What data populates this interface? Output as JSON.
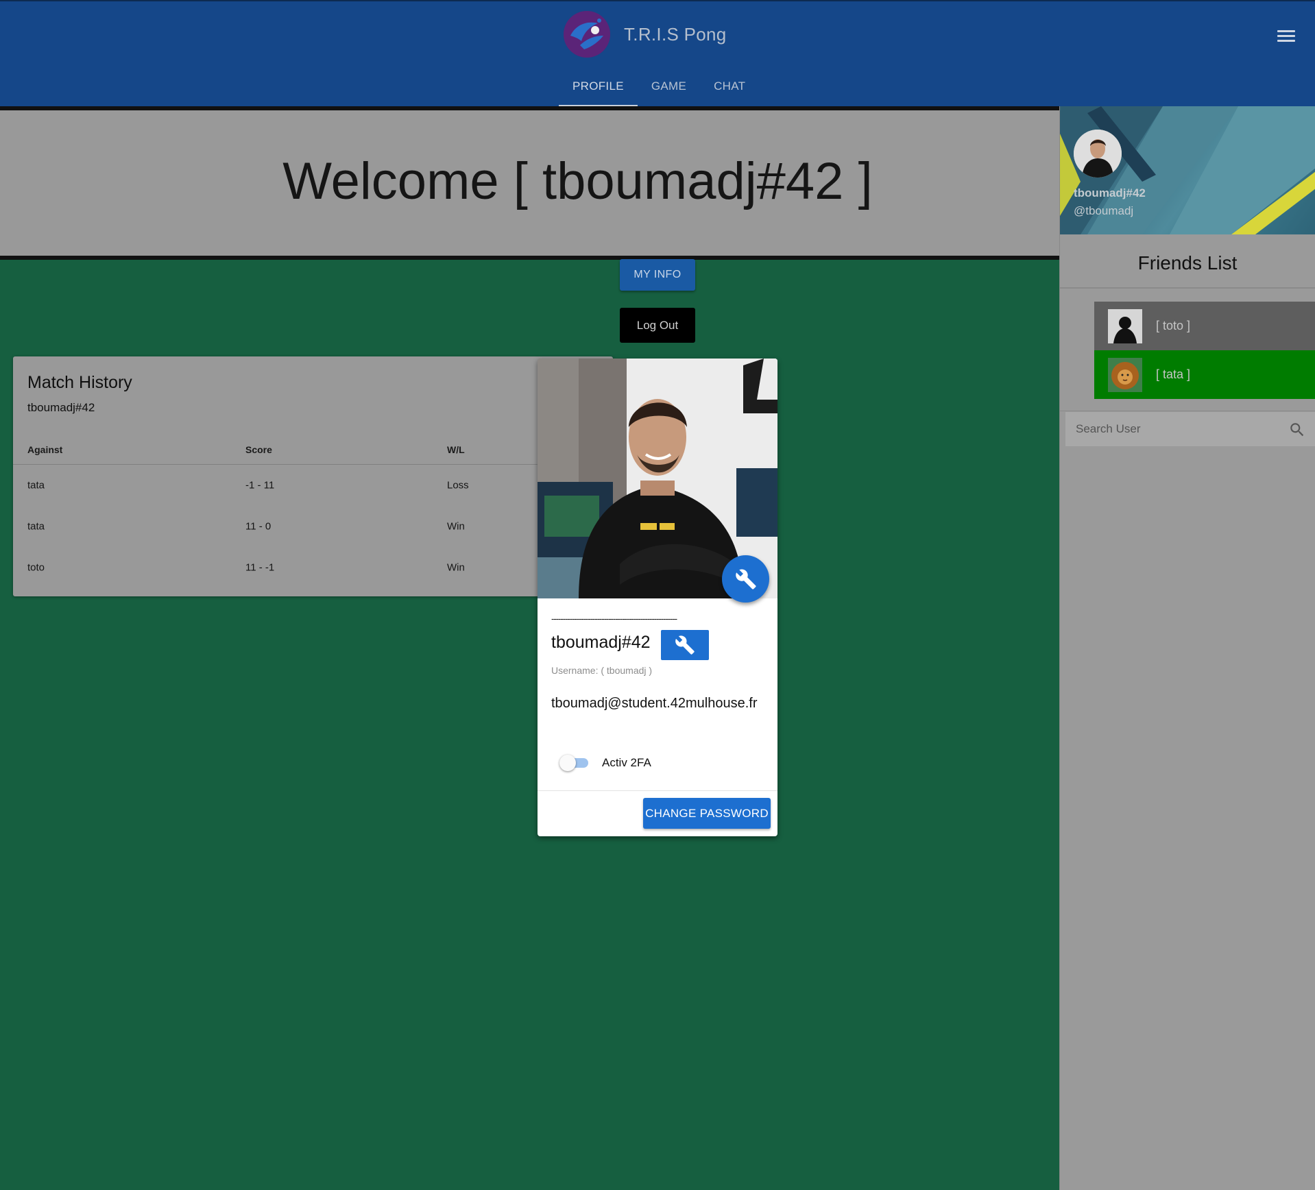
{
  "header": {
    "title": "T.R.I.S Pong",
    "tabs": [
      {
        "label": "PROFILE",
        "active": true
      },
      {
        "label": "GAME",
        "active": false
      },
      {
        "label": "CHAT",
        "active": false
      }
    ],
    "menu_icon": "hamburger-menu-icon",
    "logo_icon": "pong-logo-icon"
  },
  "welcome": {
    "text": "Welcome [ tboumadj#42 ]"
  },
  "buttons": {
    "my_info": "MY INFO",
    "log_out": "Log Out"
  },
  "match_history": {
    "title": "Match History",
    "subtitle": "tboumadj#42",
    "columns": [
      "Against",
      "Score",
      "W/L"
    ],
    "rows": [
      {
        "against": "tata",
        "score": "-1 - 11",
        "result": "Loss"
      },
      {
        "against": "tata",
        "score": "11 - 0",
        "result": "Win"
      },
      {
        "against": "toto",
        "score": "11 - -1",
        "result": "Win"
      }
    ]
  },
  "profile_card": {
    "separator": "-------------------------------------------------------",
    "display_name": "tboumadj#42",
    "username_line": "Username: ( tboumadj )",
    "email": "tboumadj@student.42mulhouse.fr",
    "twofa_label": "Activ 2FA",
    "twofa_enabled": false,
    "change_password": "CHANGE PASSWORD",
    "edit_icon": "wrench-icon"
  },
  "drawer": {
    "name": "tboumadj#42",
    "handle": "@tboumadj",
    "friends_title": "Friends List",
    "friends": [
      {
        "label": "[ toto ]",
        "color": "#5e5e5e"
      },
      {
        "label": "[ tata ]",
        "color": "#007c00"
      }
    ],
    "search_placeholder": "Search User"
  },
  "colors": {
    "appbar": "#154789",
    "background": "#165f40",
    "accent": "#1d6fd0",
    "panel": "#999999"
  }
}
